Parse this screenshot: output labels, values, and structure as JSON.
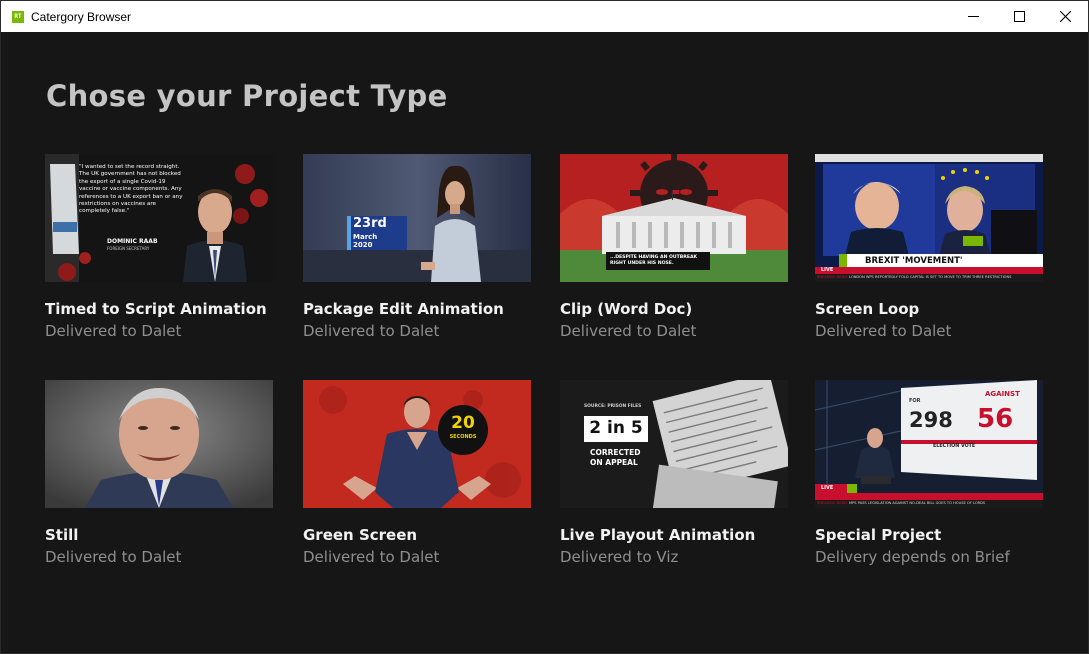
{
  "window": {
    "title": "Catergory Browser",
    "app_icon_text": "RT"
  },
  "page": {
    "title": "Chose your Project Type"
  },
  "cards": [
    {
      "title": "Timed to Script Animation",
      "subtitle": "Delivered to Dalet",
      "thumb": {
        "quote": "\"I wanted to set the record straight. The UK government has not blocked the export of a single Covid-19 vaccine or vaccine components. Any references to a UK export ban or any restrictions on vaccines are completely false.\"",
        "name": "DOMINIC RAAB",
        "role": "FOREIGN SECRETARY"
      }
    },
    {
      "title": "Package Edit Animation",
      "subtitle": "Delivered to Dalet",
      "thumb": {
        "day": "23rd",
        "month": "March",
        "year": "2020"
      }
    },
    {
      "title": "Clip (Word Doc)",
      "subtitle": "Delivered to Dalet",
      "thumb": {
        "caption": "...DESPITE HAVING AN OUTBREAK RIGHT UNDER HIS NOSE."
      }
    },
    {
      "title": "Screen Loop",
      "subtitle": "Delivered to Dalet",
      "thumb": {
        "headline": "BREXIT 'MOVEMENT'",
        "live": "LIVE",
        "ticker_label": "BREAKING NEWS",
        "ticker": "LONDON WPS REPORTEDLY FOLD CAPITAL IS SET TO MOVE TO TRIM THREE RESTRICTIONS"
      }
    },
    {
      "title": "Still",
      "subtitle": "Delivered to Dalet",
      "thumb": {}
    },
    {
      "title": "Green Screen",
      "subtitle": "Delivered to Dalet",
      "thumb": {
        "badge_number": "20",
        "badge_label": "SECONDS"
      }
    },
    {
      "title": "Live Playout Animation",
      "subtitle": "Delivered to Viz",
      "thumb": {
        "source": "SOURCE: PRISON FILES",
        "big": "2 in 5",
        "line1": "CORRECTED",
        "line2": "ON APPEAL"
      }
    },
    {
      "title": "Special Project",
      "subtitle": "Delivery depends on Brief",
      "thumb": {
        "left_label": "FOR",
        "right_label": "AGAINST",
        "left_number": "298",
        "right_number": "56",
        "vote_label": "ELECTION VOTE",
        "live": "LIVE",
        "ticker_label": "BREAKING NEWS",
        "ticker": "MPS PASS LEGISLATION AGAINST NO-DEAL BILL GOES TO HOUSE OF LORDS"
      }
    }
  ],
  "colors": {
    "background": "#161616",
    "title": "#c4c4c4",
    "card_title": "#f2f2f2",
    "card_subtitle": "#8f8f8f",
    "brand_green": "#79b700",
    "news_red": "#c8102e"
  }
}
